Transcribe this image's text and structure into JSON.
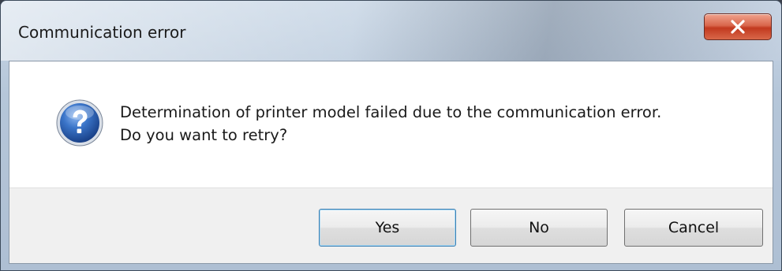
{
  "window": {
    "title": "Communication error",
    "close_icon": "close-icon"
  },
  "dialog": {
    "icon": "question-icon",
    "message_line1": "Determination of printer model failed due to the communication error.",
    "message_line2": "Do you want to retry?"
  },
  "buttons": {
    "yes_label": "Yes",
    "no_label": "No",
    "cancel_label": "Cancel"
  },
  "colors": {
    "close_button": "#c2391f",
    "question_icon": "#2a63b8",
    "default_button_border": "#3c7fb1"
  }
}
